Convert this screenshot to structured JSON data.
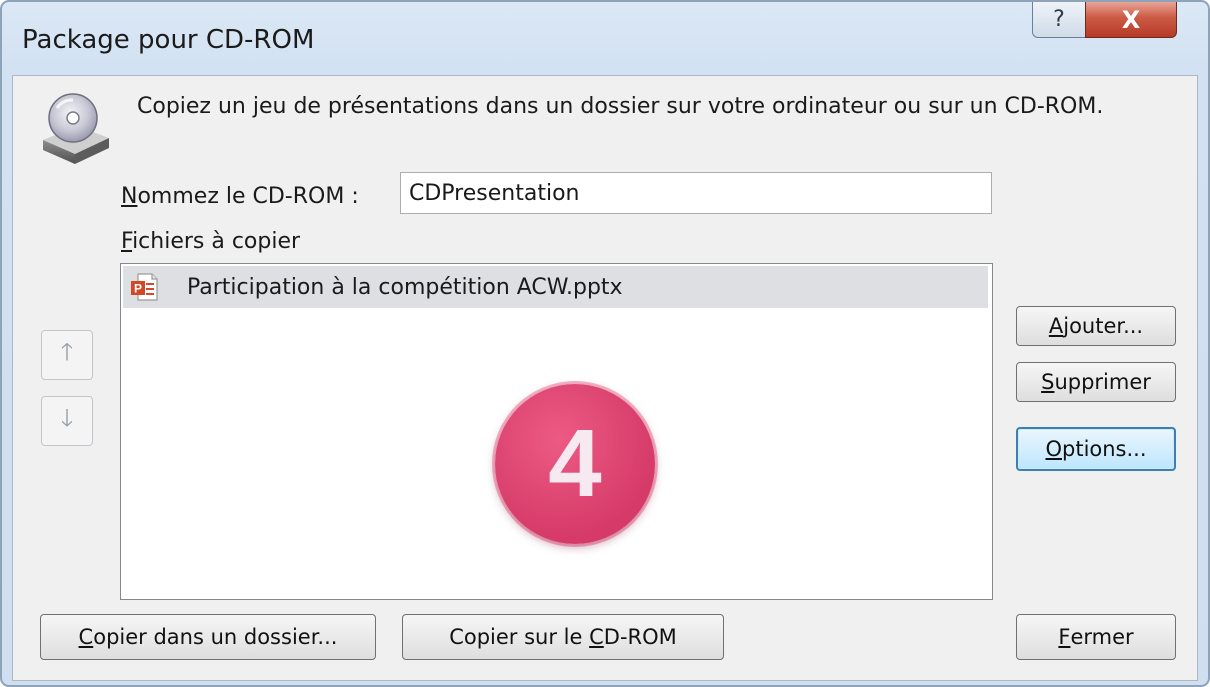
{
  "window": {
    "title": "Package pour CD-ROM",
    "help_label": "?",
    "close_label": "X"
  },
  "intro_text": "Copiez un jeu de présentations dans un dossier sur votre ordinateur ou sur un CD-ROM.",
  "name_field": {
    "label_first": "N",
    "label_rest": "ommez le CD-ROM :",
    "value": "CDPresentation"
  },
  "files": {
    "label_first": "F",
    "label_rest": "ichiers à copier",
    "items": [
      {
        "name": "Participation à la compétition ACW.pptx",
        "icon": "powerpoint-file-icon"
      }
    ]
  },
  "badge_number": "4",
  "side_buttons": {
    "add": {
      "first": "A",
      "rest": "jouter..."
    },
    "remove": {
      "first": "S",
      "rest": "upprimer"
    },
    "options": {
      "first": "O",
      "rest": "ptions..."
    }
  },
  "bottom_buttons": {
    "copy_folder": {
      "first": "C",
      "rest": "opier dans un dossier..."
    },
    "copy_cd": {
      "prefix": "Copier sur le ",
      "first": "C",
      "rest": "D-ROM"
    },
    "close": {
      "first": "F",
      "rest": "ermer"
    }
  },
  "icons": {
    "up": "arrow-up-icon",
    "down": "arrow-down-icon",
    "cd_drive": "cd-drive-icon"
  },
  "colors": {
    "accent_badge": "#d63a68",
    "default_button_border": "#3c7fb1",
    "close_button": "#c0452f"
  }
}
